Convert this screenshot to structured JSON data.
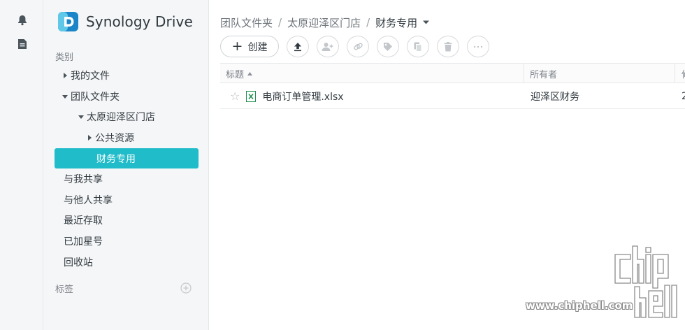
{
  "rail": {
    "icons": [
      "bell-icon",
      "document-icon"
    ]
  },
  "sidebar": {
    "brand": {
      "name": "Synology Drive"
    },
    "category_label": "类别",
    "tree": {
      "my_files": "我的文件",
      "team_folder": "团队文件夹",
      "store": "太原迎泽区门店",
      "public": "公共资源",
      "finance": "财务专用"
    },
    "items": {
      "shared_with_me": "与我共享",
      "shared_with_others": "与他人共享",
      "recent": "最近存取",
      "starred": "已加星号",
      "recycle_bin": "回收站"
    },
    "tags_label": "标签"
  },
  "main": {
    "breadcrumb": [
      "团队文件夹",
      "太原迎泽区门店",
      "财务专用"
    ],
    "breadcrumb_separator": "/",
    "toolbar": {
      "create_label": "创建",
      "icons": [
        "upload-icon",
        "share-user-icon",
        "link-icon",
        "tag-icon",
        "copy-icon",
        "delete-icon",
        "more-icon"
      ]
    },
    "columns": {
      "title": "标题",
      "owner": "所有者",
      "modified": "修"
    },
    "rows": [
      {
        "name": "电商订单管理.xlsx",
        "owner": "迎泽区财务",
        "modified": "2"
      }
    ]
  },
  "watermark": {
    "text": "www.chiphell.com"
  },
  "colors": {
    "accent": "#21bcc9",
    "sidebar_bg": "#f5f6f7",
    "excel_green": "#1f8f4e"
  }
}
